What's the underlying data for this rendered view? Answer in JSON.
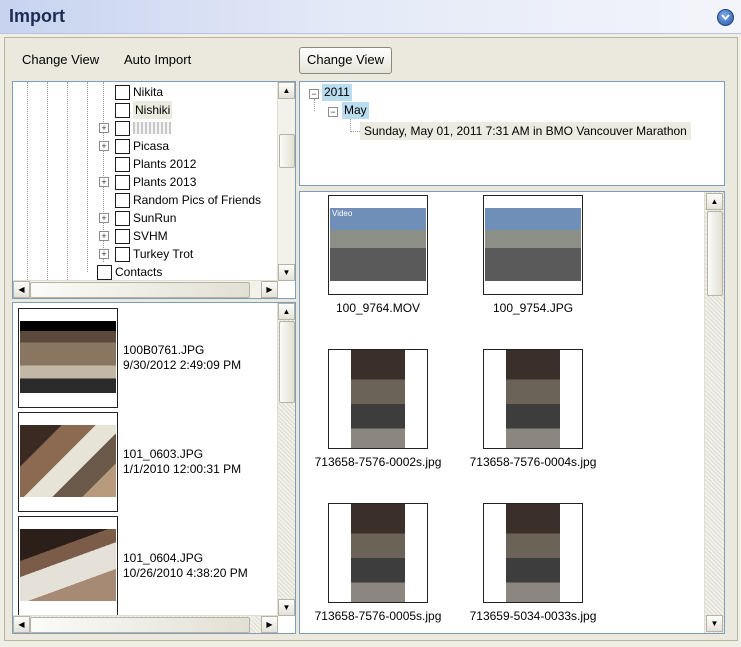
{
  "window": {
    "title": "Import"
  },
  "toolbar": {
    "change_view": "Change View",
    "auto_import": "Auto Import",
    "change_view_right": "Change View"
  },
  "folder_tree": {
    "items": [
      {
        "label": "Nikita",
        "expandable": false
      },
      {
        "label": "Nishiki",
        "expandable": false
      },
      {
        "label": "",
        "expandable": true
      },
      {
        "label": "Picasa",
        "expandable": true
      },
      {
        "label": "Plants 2012",
        "expandable": false
      },
      {
        "label": "Plants 2013",
        "expandable": true
      },
      {
        "label": "Random Pics of Friends",
        "expandable": false
      },
      {
        "label": "SunRun",
        "expandable": true
      },
      {
        "label": "SVHM",
        "expandable": true
      },
      {
        "label": "Turkey Trot",
        "expandable": true
      },
      {
        "label": "Contacts",
        "expandable": false
      }
    ]
  },
  "file_list": [
    {
      "name": "100B0761.JPG",
      "date": "9/30/2012 2:49:09 PM"
    },
    {
      "name": "101_0603.JPG",
      "date": "1/1/2010 12:00:31 PM"
    },
    {
      "name": "101_0604.JPG",
      "date": "10/26/2010 4:38:20 PM"
    }
  ],
  "date_tree": {
    "year": "2011",
    "month": "May",
    "event": "Sunday, May 01, 2011 7:31 AM in BMO Vancouver Marathon"
  },
  "gallery": [
    {
      "name": "100_9764.MOV",
      "badge": "Video"
    },
    {
      "name": "100_9754.JPG",
      "badge": ""
    },
    {
      "name": "713658-7576-0002s.jpg",
      "badge": ""
    },
    {
      "name": "713658-7576-0004s.jpg",
      "badge": ""
    },
    {
      "name": "713658-7576-0005s.jpg",
      "badge": ""
    },
    {
      "name": "713659-5034-0033s.jpg",
      "badge": ""
    }
  ]
}
